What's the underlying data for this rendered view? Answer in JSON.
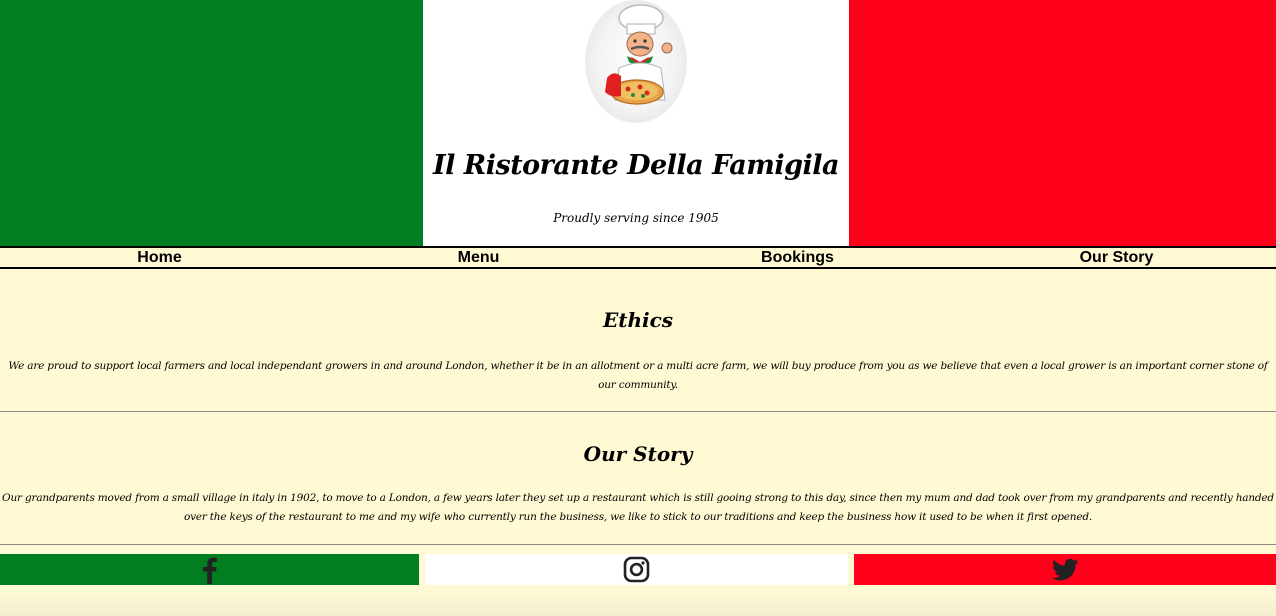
{
  "header": {
    "site_title": "Il Ristorante Della Famigila",
    "tagline": "Proudly serving since 1905",
    "logo_icon": "chef-pizza-logo",
    "flag_colors": [
      "#007e21",
      "#ffffff",
      "#ff001a"
    ]
  },
  "nav": {
    "items": [
      {
        "label": "Home"
      },
      {
        "label": "Menu"
      },
      {
        "label": "Bookings"
      },
      {
        "label": "Our Story"
      }
    ]
  },
  "sections": {
    "ethics": {
      "title": "Ethics",
      "text": "We are proud to support local farmers and local independant growers in and around London, whether it be in an allotment or a multi acre farm, we will buy produce from you as we believe that even a local grower is an important corner stone of our community."
    },
    "story": {
      "title": "Our Story",
      "text": "Our grandparents moved from a small village in italy in 1902, to move to a London, a few years later they set up a restaurant which is still gooing strong to this day, since then my mum and dad took over from my grandparents and recently handed over the keys of the restaurant to me and my wife who currently run the business, we like to stick to our traditions and keep the business how it used to be when it first opened."
    }
  },
  "footer": {
    "icons": [
      "facebook-icon",
      "instagram-icon",
      "twitter-icon"
    ],
    "background_color": "#fffad4"
  }
}
